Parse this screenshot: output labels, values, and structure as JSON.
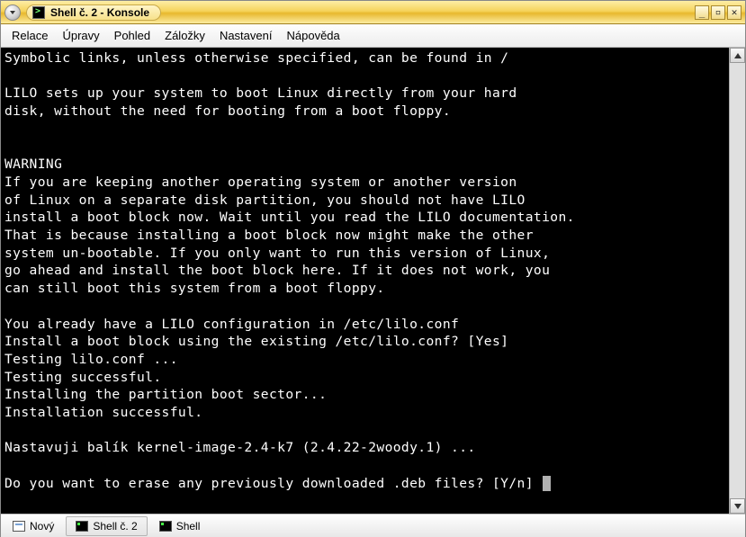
{
  "window": {
    "title": "Shell č. 2 - Konsole"
  },
  "menu": {
    "items": [
      {
        "label": "Relace"
      },
      {
        "label": "Úpravy"
      },
      {
        "label": "Pohled"
      },
      {
        "label": "Záložky"
      },
      {
        "label": "Nastavení"
      },
      {
        "label": "Nápověda"
      }
    ]
  },
  "terminal_lines": [
    "Symbolic links, unless otherwise specified, can be found in /",
    "",
    "LILO sets up your system to boot Linux directly from your hard",
    "disk, without the need for booting from a boot floppy.",
    "",
    "",
    "WARNING",
    "If you are keeping another operating system or another version",
    "of Linux on a separate disk partition, you should not have LILO",
    "install a boot block now. Wait until you read the LILO documentation.",
    "That is because installing a boot block now might make the other",
    "system un-bootable. If you only want to run this version of Linux,",
    "go ahead and install the boot block here. If it does not work, you",
    "can still boot this system from a boot floppy.",
    "",
    "You already have a LILO configuration in /etc/lilo.conf",
    "Install a boot block using the existing /etc/lilo.conf? [Yes]",
    "Testing lilo.conf ...",
    "Testing successful.",
    "Installing the partition boot sector...",
    "Installation successful.",
    "",
    "Nastavuji balík kernel-image-2.4-k7 (2.4.22-2woody.1) ...",
    "",
    "Do you want to erase any previously downloaded .deb files? [Y/n] "
  ],
  "tabs": [
    {
      "label": "Nový",
      "icon": "doc",
      "active": false
    },
    {
      "label": "Shell č. 2",
      "icon": "term",
      "active": true
    },
    {
      "label": "Shell",
      "icon": "term",
      "active": false
    }
  ]
}
